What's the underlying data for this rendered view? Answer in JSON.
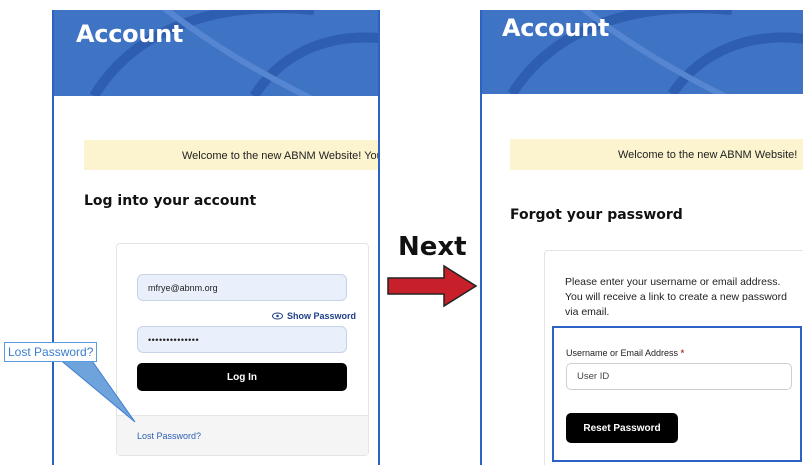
{
  "left": {
    "banner_title": "Account",
    "notice_text": "Welcome to the new ABNM Website!  Your",
    "heading": "Log into your account",
    "email_value": "mfrye@abnm.org",
    "show_password_label": "Show Password",
    "password_masked": "••••••••••••••",
    "login_button": "Log In",
    "lost_password_link": "Lost Password?"
  },
  "callout": {
    "text": "Lost Password?"
  },
  "transition": {
    "label": "Next",
    "arrow_color": "#c8202a"
  },
  "right": {
    "banner_title": "Account",
    "notice_text": "Welcome to the new ABNM Website!",
    "heading": "Forgot your password",
    "description": "Please enter your username or email address. You will receive a link to create a new password via email.",
    "field_label": "Username or Email Address",
    "required_mark": "*",
    "input_placeholder": "User ID",
    "reset_button": "Reset Password"
  },
  "colors": {
    "banner_blue": "#3f73c4",
    "highlight_border": "#2b62c4",
    "notice_yellow": "#fbf4cf"
  }
}
